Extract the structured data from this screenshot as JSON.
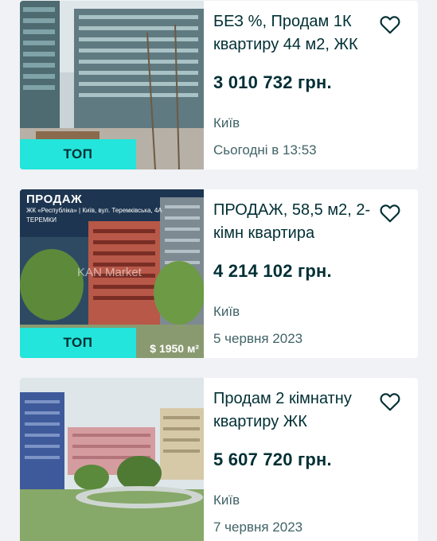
{
  "listings": [
    {
      "title": "БЕЗ %, Продам 1К квартиру 44 м2, ЖК",
      "price": "3 010 732 грн.",
      "city": "Київ",
      "date": "Сьогодні в 13:53",
      "badge": "ТОП"
    },
    {
      "title": "ПРОДАЖ, 58,5 м2, 2-кімн квартира",
      "price": "4 214 102 грн.",
      "city": "Київ",
      "date": "5 червня 2023",
      "badge": "ТОП",
      "image_overlay": {
        "heading": "ПРОДАЖ",
        "line1": "ЖК «Республіка» | Київ, вул. Теремківська, 4А",
        "line2": "ТЕРЕМКИ",
        "watermark": "KAN Market",
        "price": "$ 1950 м²"
      }
    },
    {
      "title": "Продам 2 кімнатну квартиру ЖК",
      "price": "5 607 720 грн.",
      "city": "Київ",
      "date": "7 червня 2023"
    }
  ],
  "icons": {
    "favorite": "heart-outline-icon"
  },
  "colors": {
    "badge": "#23e5db",
    "text": "#002f34",
    "muted": "#406367",
    "background": "#f0f2f5"
  }
}
